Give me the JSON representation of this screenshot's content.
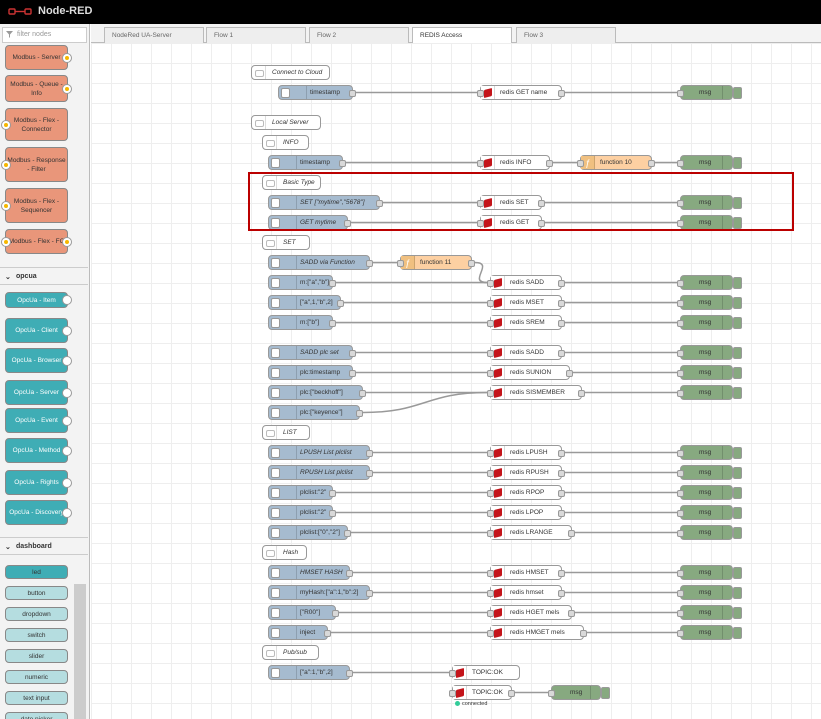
{
  "header": {
    "title": "Node-RED"
  },
  "palette": {
    "search_placeholder": "filter nodes",
    "modbus": [
      "Modbus - Server",
      "Modbus - Queue - Info",
      "Modbus - Flex - Connector",
      "Modbus - Response - Filter",
      "Modbus - Flex - Sequencer",
      "Modbus - Flex - FC"
    ],
    "cat_opcua": "opcua",
    "opcua": [
      "OpcUa - Item",
      "OpcUa - Client",
      "OpcUa - Browser",
      "OpcUa - Server",
      "OpcUa - Event",
      "OpcUa - Method",
      "OpcUa - Rights",
      "OpcUa - Discovery"
    ],
    "cat_dashboard": "dashboard",
    "dashboard": [
      "led",
      "button",
      "dropdown",
      "switch",
      "slider",
      "numeric",
      "text input",
      "date picker"
    ]
  },
  "tabs": [
    "NodeRed UA-Server",
    "Flow 1",
    "Flow 2",
    "REDIS Access",
    "Flow 3"
  ],
  "active_tab": "REDIS Access",
  "colors": {
    "inject": "#a6bbcf",
    "debug": "#87a980",
    "function": "#fdd0a2",
    "redis": "#c4141a",
    "highlight": "#b00000",
    "modbus": "#e9967a",
    "opcua": "#3fadb5",
    "dashboard": "#3fadb5"
  },
  "flow": {
    "comments": [
      "Connect to Cloud",
      "Local Server",
      "INFO",
      "Basic Type",
      "SET",
      "LIST",
      "Hash",
      "Pub/sub"
    ],
    "injects": [
      "timestamp",
      "timestamp",
      "SET [\"mytime\",\"5678\"]",
      "GET mytime",
      "SADD via Function",
      "m:[\"a\",\"b\"]",
      "[\"a\",1,\"b\",2]",
      "m:[\"b\"]",
      "SADD plc set",
      "plc:timestamp",
      "plc:[\"beckhoff\"]",
      "plc:[\"keyence\"]",
      "LPUSH List plclist",
      "RPUSH List plclist",
      "plclist:\"2\"",
      "plclist:\"2\"",
      "plclist:[\"0\",\"2\"]",
      "HMSET HASH",
      "myHash:[\"a\":1,\"b\":2]",
      "[\"R00\"]",
      "inject",
      "[\"a\":1,\"b\",2]"
    ],
    "redis": [
      "redis GET name",
      "redis INFO",
      "redis SET",
      "redis GET",
      "redis SADD",
      "redis MSET",
      "redis SREM",
      "redis SADD",
      "redis SUNION",
      "redis SISMEMBER",
      "redis LPUSH",
      "redis RPUSH",
      "redis RPOP",
      "redis LPOP",
      "redis LRANGE",
      "redis HMSET",
      "redis hmset",
      "redis HGET mels",
      "redis HMGET mels",
      "TOPIC:OK",
      "TOPIC:OK"
    ],
    "functions": [
      "function 10",
      "function 11"
    ],
    "debug_label": "msg",
    "status_connected": "connected"
  }
}
